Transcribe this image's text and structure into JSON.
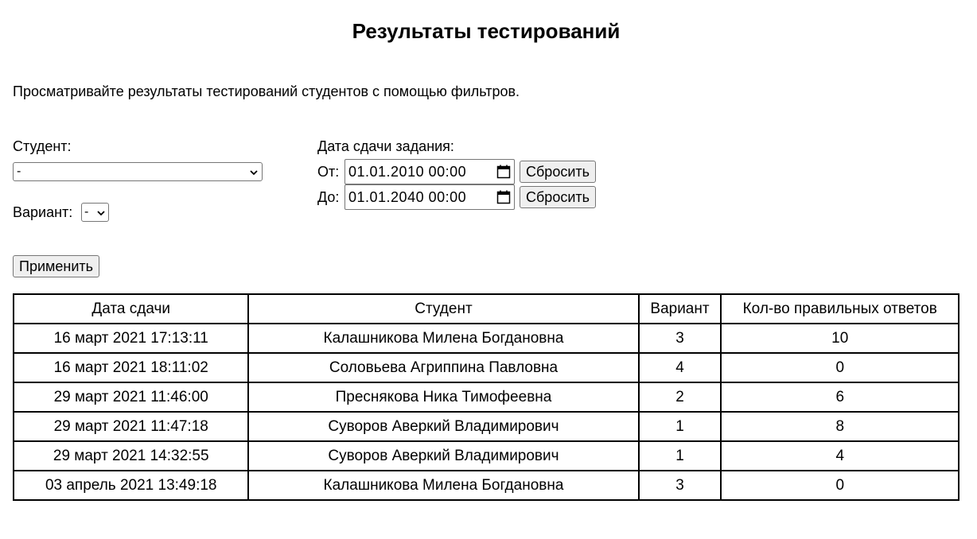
{
  "page": {
    "title": "Результаты тестирований",
    "intro": "Просматривайте результаты тестирований студентов с помощью фильтров."
  },
  "filters": {
    "student_label": "Студент:",
    "student_value": "-",
    "variant_label": "Вариант:",
    "variant_value": "-",
    "date_label": "Дата сдачи задания:",
    "from_label": "От:",
    "from_value": "01.01.2010 00:00",
    "to_label": "До:",
    "to_value": "01.01.2040 00:00",
    "reset_label": "Сбросить",
    "apply_label": "Применить"
  },
  "table": {
    "headers": [
      "Дата сдачи",
      "Студент",
      "Вариант",
      "Кол-во правильных ответов"
    ],
    "rows": [
      [
        "16 март 2021 17:13:11",
        "Калашникова Милена Богдановна",
        "3",
        "10"
      ],
      [
        "16 март 2021 18:11:02",
        "Соловьева Агриппина Павловна",
        "4",
        "0"
      ],
      [
        "29 март 2021 11:46:00",
        "Преснякова Ника Тимофеевна",
        "2",
        "6"
      ],
      [
        "29 март 2021 11:47:18",
        "Суворов Аверкий Владимирович",
        "1",
        "8"
      ],
      [
        "29 март 2021 14:32:55",
        "Суворов Аверкий Владимирович",
        "1",
        "4"
      ],
      [
        "03 апрель 2021 13:49:18",
        "Калашникова Милена Богдановна",
        "3",
        "0"
      ]
    ]
  },
  "icons": {
    "select_chevron": "chevron-down-icon",
    "date_picker": "calendar-icon"
  }
}
